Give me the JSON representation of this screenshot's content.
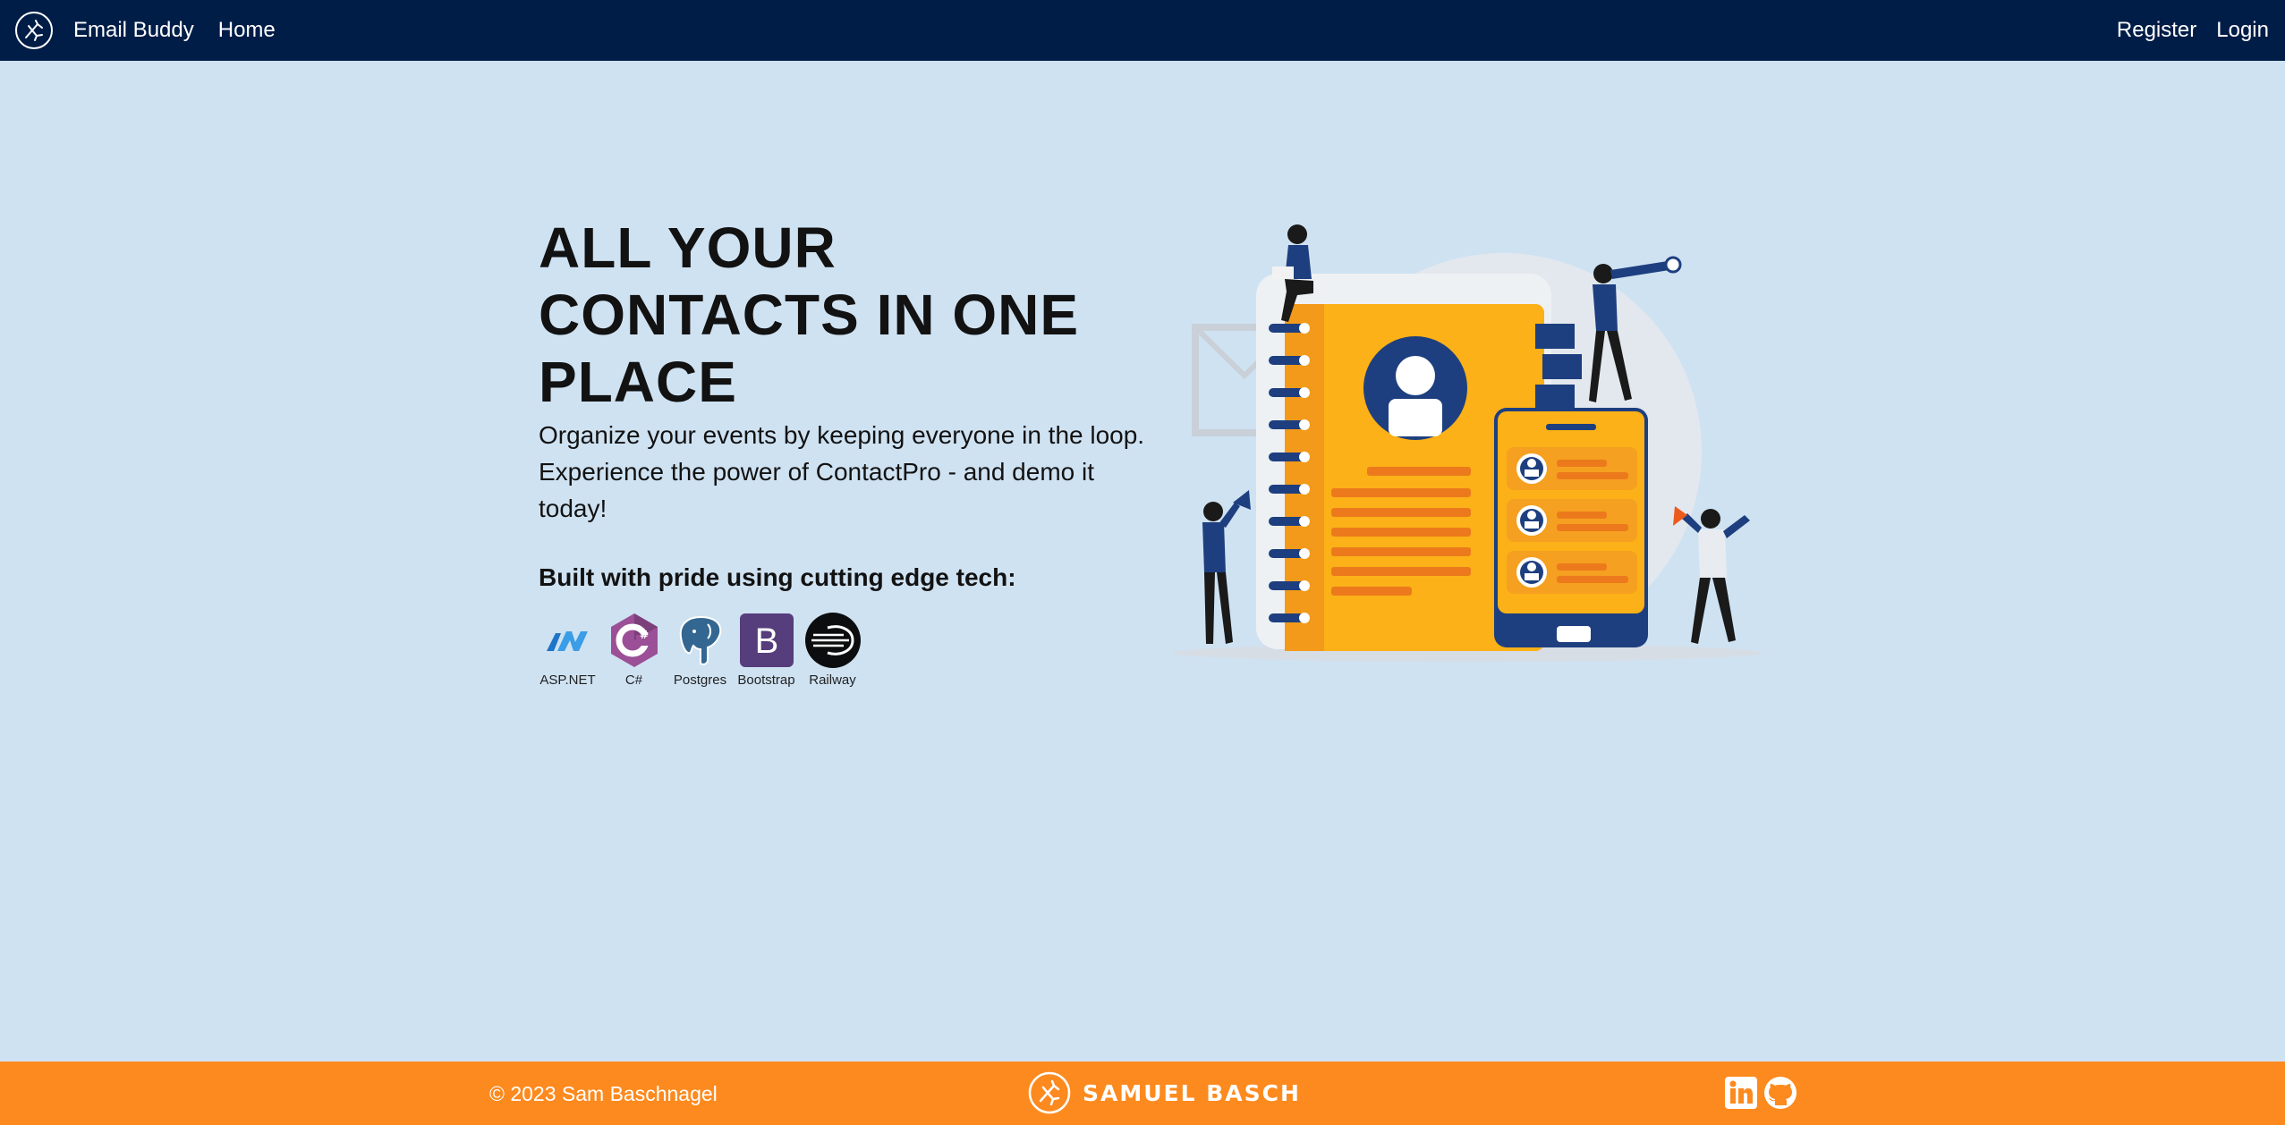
{
  "navbar": {
    "brand": "Email Buddy",
    "home": "Home",
    "register": "Register",
    "login": "Login"
  },
  "hero": {
    "title": "ALL YOUR CONTACTS IN ONE PLACE",
    "subtitle": "Organize your events by keeping everyone in the loop. Experience the power of ContactPro - and demo it today!",
    "tech_heading": "Built with pride using cutting edge tech:",
    "tech": [
      {
        "label": "ASP.NET",
        "icon": "aspnet-icon"
      },
      {
        "label": "C#",
        "icon": "csharp-icon"
      },
      {
        "label": "Postgres",
        "icon": "postgres-icon"
      },
      {
        "label": "Bootstrap",
        "icon": "bootstrap-icon"
      },
      {
        "label": "Railway",
        "icon": "railway-icon"
      }
    ]
  },
  "footer": {
    "copyright": "© 2023 Sam Baschnagel",
    "brand": "SAMUEL BASCH",
    "socials": [
      "linkedin-icon",
      "github-icon"
    ]
  },
  "colors": {
    "navbar": "#001d47",
    "background": "#cfe2f2",
    "footer": "#fd8a1e",
    "accent_orange": "#fbb117",
    "accent_blue": "#1e3f7f"
  }
}
